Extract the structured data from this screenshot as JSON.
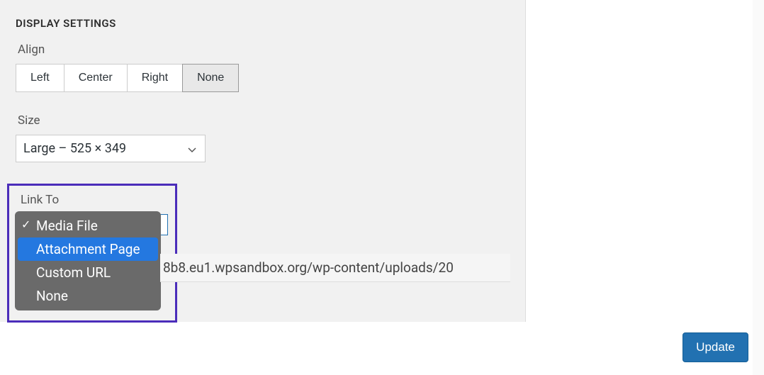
{
  "section_title": "DISPLAY SETTINGS",
  "align": {
    "label": "Align",
    "options": [
      "Left",
      "Center",
      "Right",
      "None"
    ],
    "selected": "None"
  },
  "size": {
    "label": "Size",
    "value": "Large – 525 × 349"
  },
  "link_to": {
    "label": "Link To",
    "options": [
      {
        "label": "Media File",
        "checked": true,
        "highlighted": false
      },
      {
        "label": "Attachment Page",
        "checked": false,
        "highlighted": true
      },
      {
        "label": "Custom URL",
        "checked": false,
        "highlighted": false
      },
      {
        "label": "None",
        "checked": false,
        "highlighted": false
      }
    ]
  },
  "url_field": {
    "value": "8b8.eu1.wpsandbox.org/wp-content/uploads/20"
  },
  "update_button": "Update",
  "colors": {
    "highlight_border": "#4b2dba",
    "dropdown_bg": "#6a6a6a",
    "dropdown_highlight": "#2478e0",
    "primary_button": "#2271b1"
  }
}
